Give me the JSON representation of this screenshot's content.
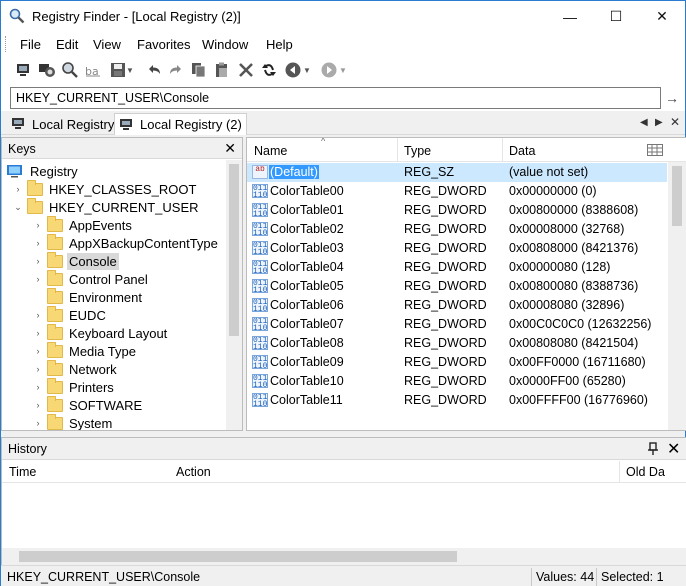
{
  "window": {
    "title": "Registry Finder - [Local Registry (2)]",
    "minimize": "—",
    "maximize": "☐",
    "close": "✕"
  },
  "menu": [
    "File",
    "Edit",
    "View",
    "Favorites",
    "Window",
    "Help"
  ],
  "toolbar": {
    "icons": [
      "computer-connect-icon",
      "connect-remote-icon",
      "find-icon",
      "rename-icon",
      "save-icon",
      "undo-icon",
      "redo-icon",
      "copy-icon",
      "paste-icon",
      "delete-icon",
      "refresh-icon",
      "back-icon",
      "forward-icon"
    ]
  },
  "address": {
    "value": "HKEY_CURRENT_USER\\Console",
    "go": "→"
  },
  "tabs": [
    {
      "label": "Local Registry",
      "active": false
    },
    {
      "label": "Local Registry (2)",
      "active": true
    }
  ],
  "tab_nav": {
    "prev": "◀",
    "next": "▶",
    "close": "✕"
  },
  "keys_pane": {
    "title": "Keys",
    "close": "✕",
    "tree": [
      {
        "label": "Registry",
        "level": 0,
        "expander": "",
        "icon": "pc"
      },
      {
        "label": "HKEY_CLASSES_ROOT",
        "level": 1,
        "expander": "›"
      },
      {
        "label": "HKEY_CURRENT_USER",
        "level": 1,
        "expander": "⌄"
      },
      {
        "label": "AppEvents",
        "level": 2,
        "expander": "›"
      },
      {
        "label": "AppXBackupContentType",
        "level": 2,
        "expander": "›"
      },
      {
        "label": "Console",
        "level": 2,
        "expander": "›",
        "selected": true
      },
      {
        "label": "Control Panel",
        "level": 2,
        "expander": "›"
      },
      {
        "label": "Environment",
        "level": 2,
        "expander": ""
      },
      {
        "label": "EUDC",
        "level": 2,
        "expander": "›"
      },
      {
        "label": "Keyboard Layout",
        "level": 2,
        "expander": "›"
      },
      {
        "label": "Media Type",
        "level": 2,
        "expander": "›"
      },
      {
        "label": "Network",
        "level": 2,
        "expander": "›"
      },
      {
        "label": "Printers",
        "level": 2,
        "expander": "›"
      },
      {
        "label": "SOFTWARE",
        "level": 2,
        "expander": "›"
      },
      {
        "label": "System",
        "level": 2,
        "expander": "›"
      }
    ]
  },
  "values_pane": {
    "columns": {
      "name": "Name",
      "type": "Type",
      "data": "Data"
    },
    "rows": [
      {
        "name": "(Default)",
        "type": "REG_SZ",
        "data": "(value not set)",
        "kind": "sz",
        "selected": true
      },
      {
        "name": "ColorTable00",
        "type": "REG_DWORD",
        "data": "0x00000000 (0)",
        "kind": "dword"
      },
      {
        "name": "ColorTable01",
        "type": "REG_DWORD",
        "data": "0x00800000 (8388608)",
        "kind": "dword"
      },
      {
        "name": "ColorTable02",
        "type": "REG_DWORD",
        "data": "0x00008000 (32768)",
        "kind": "dword"
      },
      {
        "name": "ColorTable03",
        "type": "REG_DWORD",
        "data": "0x00808000 (8421376)",
        "kind": "dword"
      },
      {
        "name": "ColorTable04",
        "type": "REG_DWORD",
        "data": "0x00000080 (128)",
        "kind": "dword"
      },
      {
        "name": "ColorTable05",
        "type": "REG_DWORD",
        "data": "0x00800080 (8388736)",
        "kind": "dword"
      },
      {
        "name": "ColorTable06",
        "type": "REG_DWORD",
        "data": "0x00008080 (32896)",
        "kind": "dword"
      },
      {
        "name": "ColorTable07",
        "type": "REG_DWORD",
        "data": "0x00C0C0C0 (12632256)",
        "kind": "dword"
      },
      {
        "name": "ColorTable08",
        "type": "REG_DWORD",
        "data": "0x00808080 (8421504)",
        "kind": "dword"
      },
      {
        "name": "ColorTable09",
        "type": "REG_DWORD",
        "data": "0x00FF0000 (16711680)",
        "kind": "dword"
      },
      {
        "name": "ColorTable10",
        "type": "REG_DWORD",
        "data": "0x0000FF00 (65280)",
        "kind": "dword"
      },
      {
        "name": "ColorTable11",
        "type": "REG_DWORD",
        "data": "0x00FFFF00 (16776960)",
        "kind": "dword"
      }
    ]
  },
  "history_pane": {
    "title": "History",
    "pin": "📌",
    "close": "✕",
    "columns": {
      "time": "Time",
      "action": "Action",
      "old_data": "Old Da"
    }
  },
  "status": {
    "path": "HKEY_CURRENT_USER\\Console",
    "values": "Values: 44",
    "selected": "Selected: 1"
  },
  "colors": {
    "accent": "#3399ff",
    "selection_bg": "#cce8ff",
    "folder": "#f8d775"
  }
}
